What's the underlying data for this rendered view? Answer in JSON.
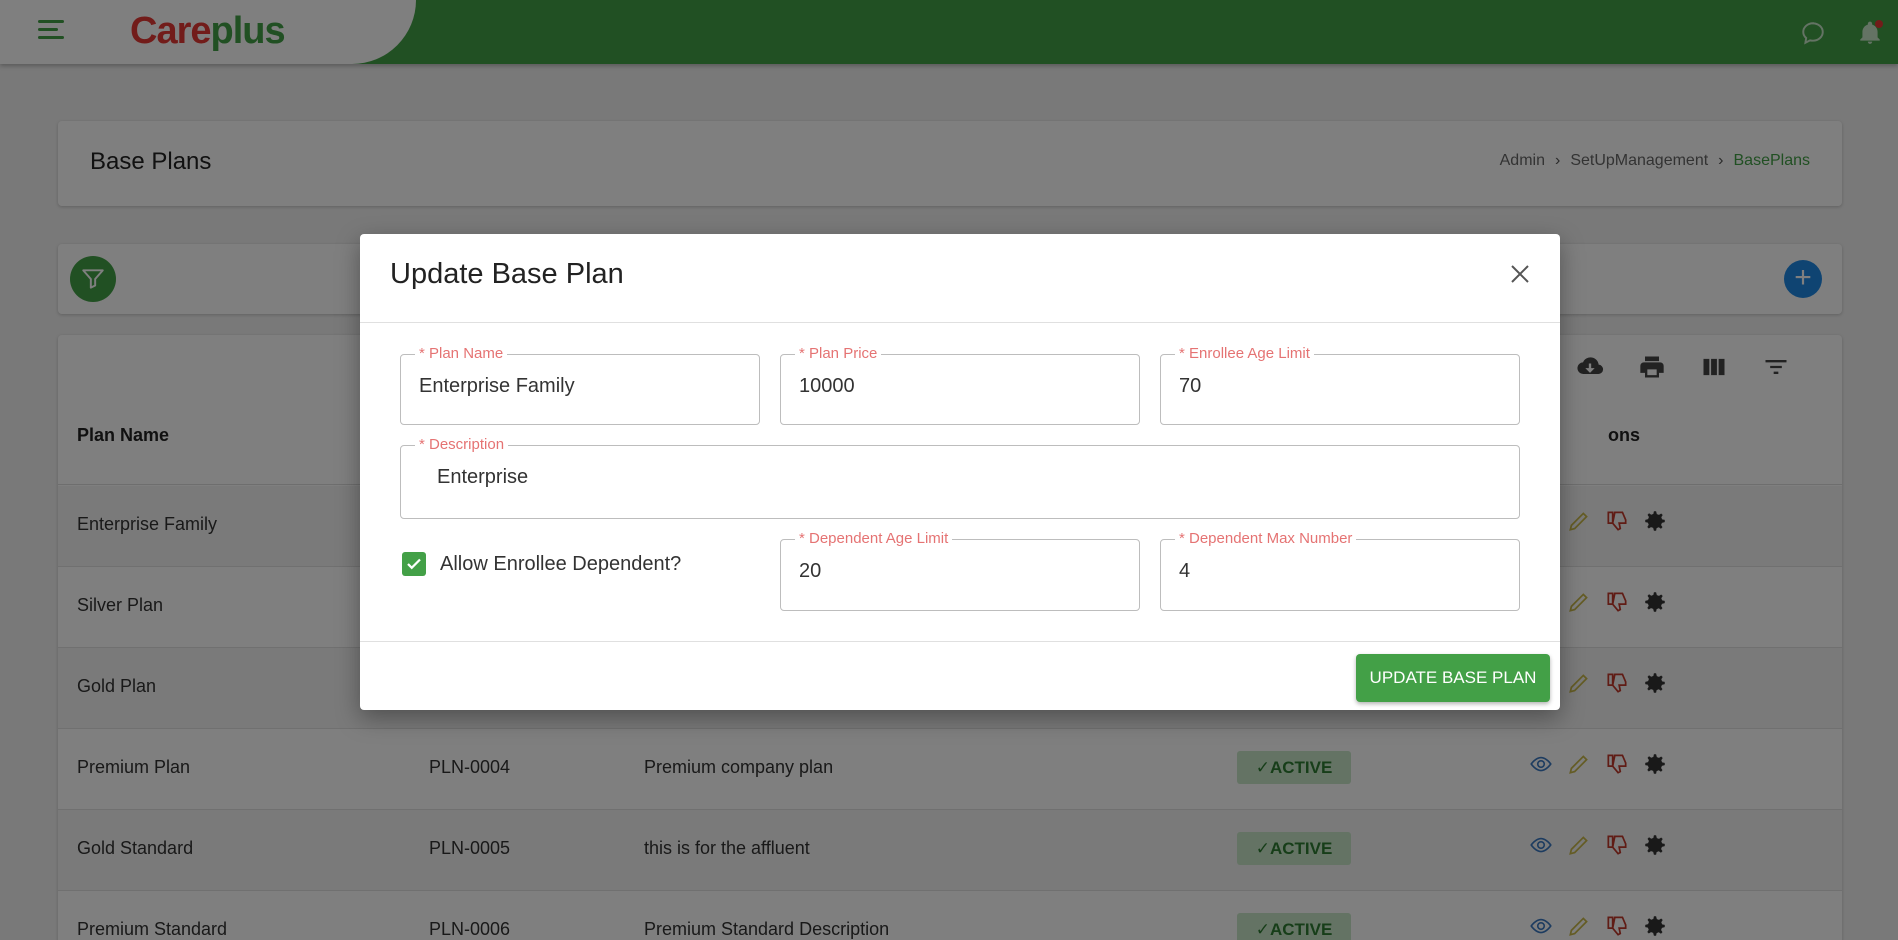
{
  "header": {
    "logo_part1": "Care",
    "logo_part2": "plus",
    "brand_green": "#43a047",
    "brand_red": "#e53935"
  },
  "page": {
    "title": "Base Plans",
    "breadcrumb": [
      "Admin",
      "SetUpManagement",
      "BasePlans"
    ]
  },
  "table": {
    "headers": {
      "plan_name": "Plan Name",
      "actions": "ons"
    },
    "rows": [
      {
        "name": "Enterprise Family",
        "code": "",
        "description": "",
        "status": ""
      },
      {
        "name": "Silver Plan",
        "code": "",
        "description": "",
        "status": ""
      },
      {
        "name": "Gold Plan",
        "code": "",
        "description": "",
        "status": ""
      },
      {
        "name": "Premium Plan",
        "code": "PLN-0004",
        "description": "Premium company plan",
        "status": "✓ACTIVE"
      },
      {
        "name": "Gold Standard",
        "code": "PLN-0005",
        "description": "this is for the affluent",
        "status": "✓ACTIVE"
      },
      {
        "name": "Premium Standard",
        "code": "PLN-0006",
        "description": "Premium Standard Description",
        "status": "✓ACTIVE"
      }
    ]
  },
  "modal": {
    "title": "Update Base Plan",
    "fields": {
      "plan_name": {
        "label": "* Plan Name",
        "value": "Enterprise Family"
      },
      "plan_price": {
        "label": "* Plan Price",
        "value": "10000"
      },
      "enrollee_age_limit": {
        "label": "* Enrollee Age Limit",
        "value": "70"
      },
      "description": {
        "label": "* Description",
        "value": "Enterprise"
      },
      "dependent_age_limit": {
        "label": "* Dependent Age Limit",
        "value": "20"
      },
      "dependent_max_number": {
        "label": "* Dependent Max Number",
        "value": "4"
      }
    },
    "allow_dependent": {
      "label": "Allow Enrollee Dependent?",
      "checked": true
    },
    "submit_label": "UPDATE BASE PLAN"
  }
}
